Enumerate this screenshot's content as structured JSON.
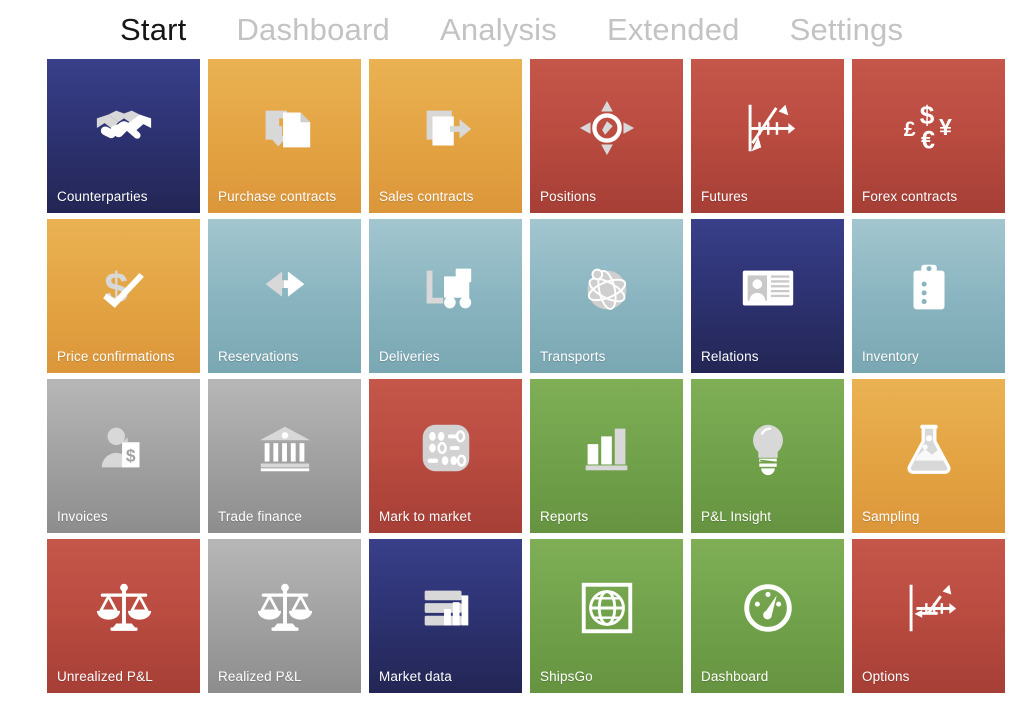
{
  "nav": {
    "tabs": [
      {
        "label": "Start",
        "active": true
      },
      {
        "label": "Dashboard",
        "active": false
      },
      {
        "label": "Analysis",
        "active": false
      },
      {
        "label": "Extended",
        "active": false
      },
      {
        "label": "Settings",
        "active": false
      }
    ]
  },
  "colors": {
    "navy": "#2e3374",
    "orange": "#e3a342",
    "red": "#b94b40",
    "teal": "#8ab5c0",
    "gray": "#a2a2a2",
    "green": "#71a24b",
    "tile_label": "#ffffff",
    "nav_active": "#161616",
    "nav_inactive": "#c3c3c3",
    "page_background": "#ffffff"
  },
  "tiles": [
    {
      "label": "Counterparties",
      "icon": "handshake-icon",
      "color": "navy"
    },
    {
      "label": "Purchase contracts",
      "icon": "document-in-icon",
      "color": "orange"
    },
    {
      "label": "Sales contracts",
      "icon": "document-out-icon",
      "color": "orange"
    },
    {
      "label": "Positions",
      "icon": "compass-icon",
      "color": "red"
    },
    {
      "label": "Futures",
      "icon": "chart-trend-icon",
      "color": "red"
    },
    {
      "label": "Forex contracts",
      "icon": "currencies-icon",
      "color": "red"
    },
    {
      "label": "Price confirmations",
      "icon": "dollar-check-icon",
      "color": "orange"
    },
    {
      "label": "Reservations",
      "icon": "two-arrows-icon",
      "color": "teal"
    },
    {
      "label": "Deliveries",
      "icon": "forklift-icon",
      "color": "teal"
    },
    {
      "label": "Transports",
      "icon": "globe-sphere-icon",
      "color": "teal"
    },
    {
      "label": "Relations",
      "icon": "id-card-icon",
      "color": "navy"
    },
    {
      "label": "Inventory",
      "icon": "clipboard-icon",
      "color": "teal"
    },
    {
      "label": "Invoices",
      "icon": "person-invoice-icon",
      "color": "gray"
    },
    {
      "label": "Trade finance",
      "icon": "bank-icon",
      "color": "gray"
    },
    {
      "label": "Mark to market",
      "icon": "binary-pad-icon",
      "color": "red"
    },
    {
      "label": "Reports",
      "icon": "bar-chart-icon",
      "color": "green"
    },
    {
      "label": "P&L Insight",
      "icon": "lightbulb-icon",
      "color": "green"
    },
    {
      "label": "Sampling",
      "icon": "flask-icon",
      "color": "orange"
    },
    {
      "label": "Unrealized P&L",
      "icon": "scales-icon",
      "color": "red"
    },
    {
      "label": "Realized P&L",
      "icon": "scales-icon",
      "color": "gray"
    },
    {
      "label": "Market data",
      "icon": "server-chart-icon",
      "color": "navy"
    },
    {
      "label": "ShipsGo",
      "icon": "globe-box-icon",
      "color": "green"
    },
    {
      "label": "Dashboard",
      "icon": "gauge-icon",
      "color": "green"
    },
    {
      "label": "Options",
      "icon": "chart-step-icon",
      "color": "red"
    }
  ]
}
